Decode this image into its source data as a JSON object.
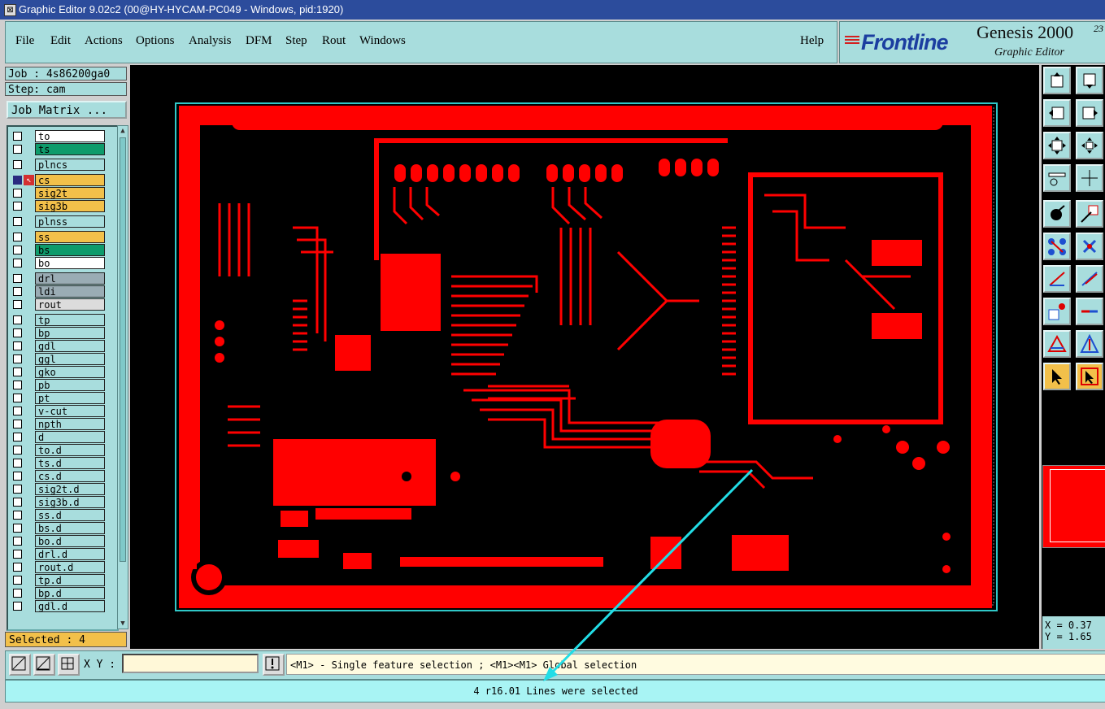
{
  "window": {
    "title": "Graphic Editor 9.02c2 (00@HY-HYCAM-PC049 - Windows, pid:1920)"
  },
  "menu": {
    "items": [
      "File",
      "Edit",
      "Actions",
      "Options",
      "Analysis",
      "DFM",
      "Step",
      "Rout",
      "Windows"
    ],
    "help": "Help"
  },
  "brand": {
    "logo": "Frontline",
    "product": "Genesis 2000",
    "version_sup": "23",
    "subtitle": "Graphic Editor"
  },
  "job": {
    "job_label": "Job : 4s86200ga0",
    "step_label": "Step: cam",
    "matrix_button": "Job Matrix ..."
  },
  "layers": [
    {
      "name": "to",
      "color": "#ffffff",
      "checked": false
    },
    {
      "name": "ts",
      "color": "#0e9b6b",
      "checked": false
    },
    {
      "name": "plncs",
      "color": "#a8dddd",
      "checked": false
    },
    {
      "name": "cs",
      "color": "#f2c04a",
      "checked": true,
      "work": true
    },
    {
      "name": "sig2t",
      "color": "#f2c04a",
      "checked": false
    },
    {
      "name": "sig3b",
      "color": "#f2c04a",
      "checked": false
    },
    {
      "name": "plnss",
      "color": "#a8dddd",
      "checked": false
    },
    {
      "name": "ss",
      "color": "#f2c04a",
      "checked": false
    },
    {
      "name": "bs",
      "color": "#0e9b6b",
      "checked": false
    },
    {
      "name": "bo",
      "color": "#ffffff",
      "checked": false
    },
    {
      "name": "drl",
      "color": "#9aacb4",
      "checked": false
    },
    {
      "name": "ldi",
      "color": "#9aacb4",
      "checked": false
    },
    {
      "name": "rout",
      "color": "#dcdcdc",
      "checked": false
    },
    {
      "name": "tp",
      "color": "#a8dddd",
      "checked": false
    },
    {
      "name": "bp",
      "color": "#a8dddd",
      "checked": false
    },
    {
      "name": "gdl",
      "color": "#a8dddd",
      "checked": false
    },
    {
      "name": "ggl",
      "color": "#a8dddd",
      "checked": false
    },
    {
      "name": "gko",
      "color": "#a8dddd",
      "checked": false
    },
    {
      "name": "pb",
      "color": "#a8dddd",
      "checked": false
    },
    {
      "name": "pt",
      "color": "#a8dddd",
      "checked": false
    },
    {
      "name": "v-cut",
      "color": "#a8dddd",
      "checked": false
    },
    {
      "name": "npth",
      "color": "#a8dddd",
      "checked": false
    },
    {
      "name": "d",
      "color": "#a8dddd",
      "checked": false
    },
    {
      "name": "to.d",
      "color": "#a8dddd",
      "checked": false
    },
    {
      "name": "ts.d",
      "color": "#a8dddd",
      "checked": false
    },
    {
      "name": "cs.d",
      "color": "#a8dddd",
      "checked": false
    },
    {
      "name": "sig2t.d",
      "color": "#a8dddd",
      "checked": false
    },
    {
      "name": "sig3b.d",
      "color": "#a8dddd",
      "checked": false
    },
    {
      "name": "ss.d",
      "color": "#a8dddd",
      "checked": false
    },
    {
      "name": "bs.d",
      "color": "#a8dddd",
      "checked": false
    },
    {
      "name": "bo.d",
      "color": "#a8dddd",
      "checked": false
    },
    {
      "name": "drl.d",
      "color": "#a8dddd",
      "checked": false
    },
    {
      "name": "rout.d",
      "color": "#a8dddd",
      "checked": false
    },
    {
      "name": "tp.d",
      "color": "#a8dddd",
      "checked": false
    },
    {
      "name": "bp.d",
      "color": "#a8dddd",
      "checked": false
    },
    {
      "name": "gdl.d",
      "color": "#a8dddd",
      "checked": false
    }
  ],
  "selected_label": "Selected : 4",
  "coords": {
    "x": "X = 0.37",
    "y": "Y = 1.65"
  },
  "input": {
    "xy_label": "X Y :",
    "xy_value": ""
  },
  "hint": "<M1> - Single feature selection ; <M1><M1> Global selection",
  "status": "4 r16.01 Lines were selected",
  "colors": {
    "copper": "#ff0000",
    "panel": "#a8dddd",
    "highlight": "#f2c04a",
    "annotation": "#22dde6"
  }
}
